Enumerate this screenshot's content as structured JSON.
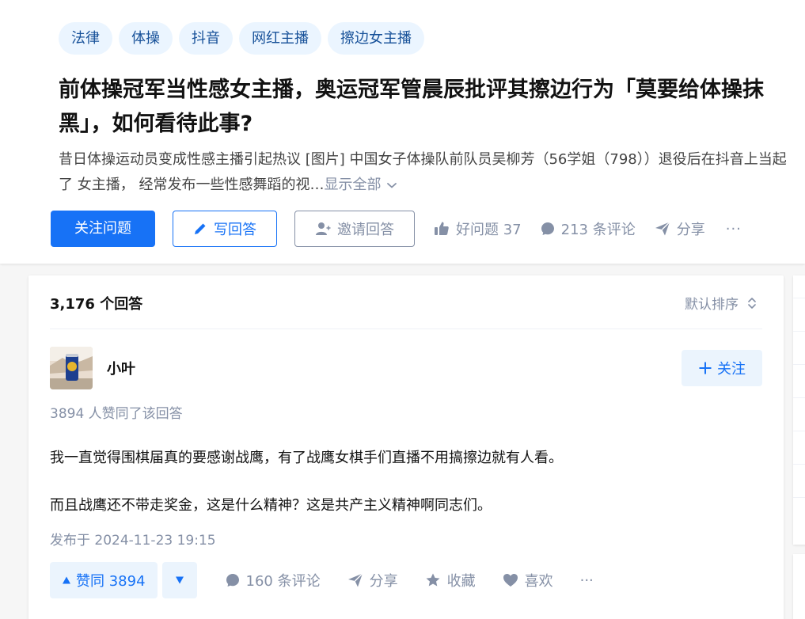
{
  "question": {
    "topics": [
      "法律",
      "体操",
      "抖音",
      "网红主播",
      "擦边女主播"
    ],
    "title": "前体操冠军当性感女主播，奥运冠军管晨辰批评其擦边行为「莫要给体操抹黑」，如何看待此事?",
    "excerpt": "昔日体操运动员变成性感主播引起热议 [图片] 中国女子体操队前队员吴柳芳（56学姐（798））退役后在抖音上当起了 女主播， 经常发布一些性感舞蹈的视…",
    "show_all": "显示全部",
    "actions": {
      "follow": "关注问题",
      "write_answer": "写回答",
      "invite": "邀请回答",
      "good_question": "好问题 37",
      "comments": "213 条评论",
      "share": "分享",
      "more": "···"
    }
  },
  "answers": {
    "count_label": "3,176 个回答",
    "sort_label": "默认排序",
    "first": {
      "author_name": "小叶",
      "follow_label": "关注",
      "vote_summary": "3894 人赞同了该回答",
      "paragraphs": [
        "我一直觉得围棋届真的要感谢战鹰，有了战鹰女棋手们直播不用搞擦边就有人看。",
        "而且战鹰还不带走奖金，这是什么精神？这是共产主义精神啊同志们。"
      ],
      "publish_time": "发布于 2024-11-23 19:15",
      "upvote_label": "赞同 3894",
      "comments": "160 条评论",
      "share": "分享",
      "collect": "收藏",
      "like": "喜欢",
      "more": "···"
    }
  },
  "colors": {
    "brand": "#1772f6",
    "muted": "#8590a6",
    "tag_bg": "#ebf5ff",
    "tag_text": "#175199"
  },
  "icons": [
    "pencil-icon",
    "add-user-icon",
    "thumbs-up-icon",
    "comment-icon",
    "share-icon",
    "sort-icon",
    "plus-icon",
    "triangle-up-icon",
    "triangle-down-icon",
    "star-icon",
    "heart-icon",
    "chevron-down-icon"
  ]
}
